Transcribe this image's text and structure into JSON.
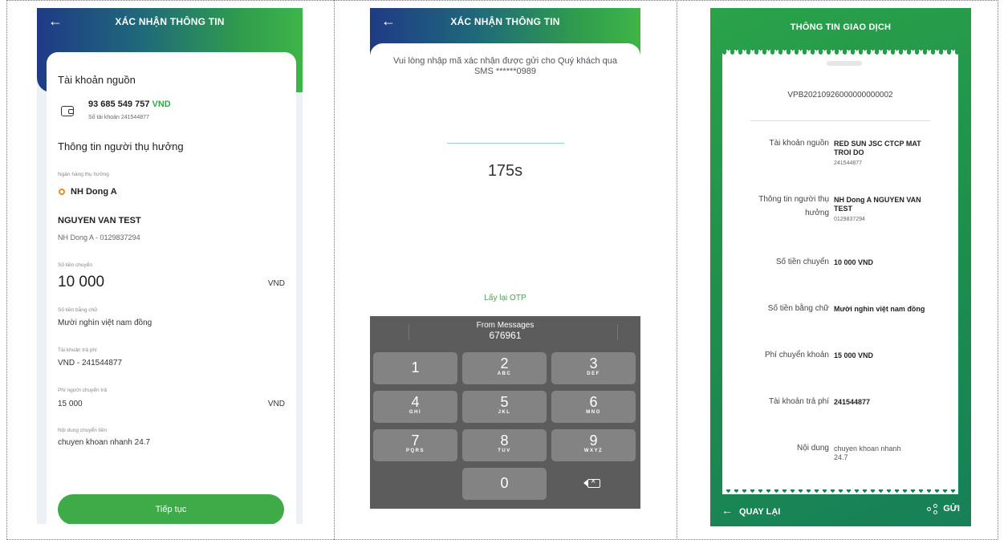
{
  "screen1": {
    "header": {
      "back_icon": "←",
      "title": "XÁC NHẬN THÔNG TIN"
    },
    "source": {
      "section_title": "Tài khoản nguồn",
      "account_number": "93 685 549 757",
      "currency": "VND",
      "account_sub": "Số tài khoản 241544877"
    },
    "beneficiary": {
      "section_title": "Thông tin người thụ hưởng",
      "bank_label": "Ngân hàng thụ hưởng",
      "bank_name": "NH Dong A",
      "name": "NGUYEN VAN TEST",
      "detail": "NH Dong A - 0129837294"
    },
    "amount": {
      "label": "Số tiền chuyển",
      "value": "10 000",
      "currency": "VND"
    },
    "amount_words": {
      "label": "Số tiền bằng chữ",
      "value": "Mười nghìn việt nam đồng"
    },
    "fee_account": {
      "label": "Tài khoản trả phí",
      "value": "VND - 241544877"
    },
    "fee": {
      "label": "Phí người chuyển trả",
      "value": "15 000",
      "currency": "VND"
    },
    "content": {
      "label": "Nội dung chuyển tiền",
      "value": "chuyen khoan nhanh 24.7"
    },
    "continue_button": "Tiếp tục"
  },
  "screen2": {
    "header": {
      "back_icon": "←",
      "title": "XÁC NHẬN THÔNG TIN"
    },
    "message": "Vui lòng nhập mã xác nhận được gửi cho Quý khách qua SMS ******0989",
    "timer": "175s",
    "resend": "Lấy lại OTP",
    "suggestion": {
      "source": "From Messages",
      "code": "676961"
    },
    "keys": [
      {
        "digit": "1",
        "letters": ""
      },
      {
        "digit": "2",
        "letters": "ABC"
      },
      {
        "digit": "3",
        "letters": "DEF"
      },
      {
        "digit": "4",
        "letters": "GHI"
      },
      {
        "digit": "5",
        "letters": "JKL"
      },
      {
        "digit": "6",
        "letters": "MNO"
      },
      {
        "digit": "7",
        "letters": "PQRS"
      },
      {
        "digit": "8",
        "letters": "TUV"
      },
      {
        "digit": "9",
        "letters": "WXYZ"
      },
      {
        "digit": "0",
        "letters": ""
      }
    ]
  },
  "screen3": {
    "title": "THÔNG TIN GIAO DỊCH",
    "transaction_code": "VPB20210926000000000002",
    "rows": [
      {
        "label": "Tài khoản nguồn",
        "value": "RED SUN JSC CTCP MAT TROI DO",
        "sub": "241544877"
      },
      {
        "label": "Thông tin người thụ hưởng",
        "value": "NH Dong A NGUYEN VAN TEST",
        "sub": "0129837294"
      },
      {
        "label": "Số tiền chuyển",
        "value": "10 000 VND",
        "sub": ""
      },
      {
        "label": "Số tiền bằng chữ",
        "value": "Mười nghìn việt nam đồng",
        "sub": ""
      },
      {
        "label": "Phí chuyển khoản",
        "value": "15 000 VND",
        "sub": ""
      },
      {
        "label": "Tài khoản trả phí",
        "value": "241544877",
        "sub": ""
      },
      {
        "label": "Nội dung",
        "value": "chuyen khoan nhanh 24.7",
        "sub": ""
      }
    ],
    "back_label": "QUAY LẠI",
    "send_label": "GỬI"
  },
  "colors": {
    "primary_green": "#3eab48",
    "header_blue": "#1f3a86",
    "accent_orange": "#f08a24"
  }
}
